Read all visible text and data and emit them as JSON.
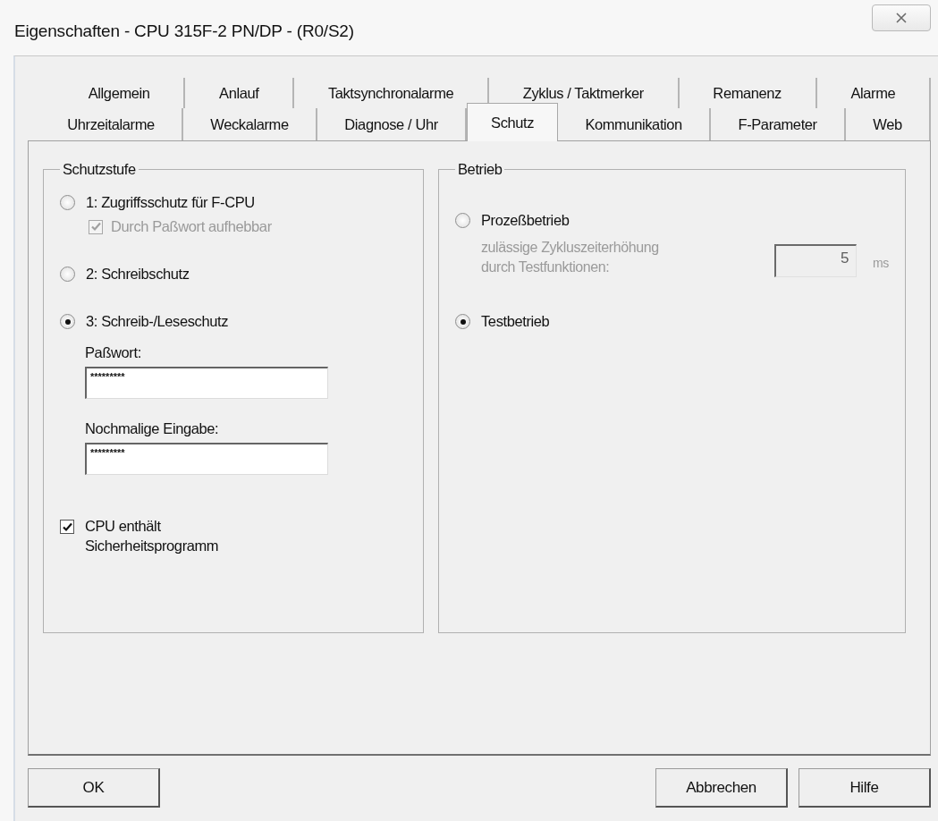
{
  "window": {
    "title": "Eigenschaften - CPU 315F-2 PN/DP - (R0/S2)"
  },
  "tabs": {
    "rows": [
      {
        "tabs": [
          {
            "label": "Allgemein",
            "selected": false
          },
          {
            "label": "Anlauf",
            "selected": false
          },
          {
            "label": "Taktsynchronalarme",
            "selected": false
          },
          {
            "label": "Zyklus / Taktmerker",
            "selected": false
          },
          {
            "label": "Remanenz",
            "selected": false
          },
          {
            "label": "Alarme",
            "selected": false
          }
        ]
      },
      {
        "tabs": [
          {
            "label": "Uhrzeitalarme",
            "selected": false
          },
          {
            "label": "Weckalarme",
            "selected": false
          },
          {
            "label": "Diagnose / Uhr",
            "selected": false
          },
          {
            "label": "Schutz",
            "selected": true
          },
          {
            "label": "Kommunikation",
            "selected": false
          },
          {
            "label": "F-Parameter",
            "selected": false
          },
          {
            "label": "Web",
            "selected": false
          }
        ]
      }
    ]
  },
  "protection": {
    "title": "Schutzstufe",
    "options": [
      {
        "label": "1: Zugriffsschutz für F-CPU",
        "selected": false,
        "checkbox": {
          "label": "Durch Paßwort aufhebbar",
          "checked": true,
          "disabled": true
        }
      },
      {
        "label": "2: Schreibschutz",
        "selected": false
      },
      {
        "label": "3: Schreib-/Leseschutz",
        "selected": true,
        "fields": [
          {
            "label": "Paßwort:",
            "value": "*********"
          },
          {
            "label": "Nochmalige Eingabe:",
            "value": "*********"
          }
        ]
      }
    ],
    "safety_checkbox": {
      "label": "CPU enthält Sicherheitsprogramm",
      "checked": true,
      "disabled": false
    }
  },
  "operation": {
    "title": "Betrieb",
    "options": [
      {
        "label": "Prozeßbetrieb",
        "selected": false,
        "setting": {
          "label": "zulässige Zykluszeiterhöhung durch Testfunktionen:",
          "value": "5",
          "unit": "ms",
          "disabled": true
        }
      },
      {
        "label": "Testbetrieb",
        "selected": true
      }
    ]
  },
  "buttons": [
    "OK",
    "Abbrechen",
    "Hilfe"
  ]
}
